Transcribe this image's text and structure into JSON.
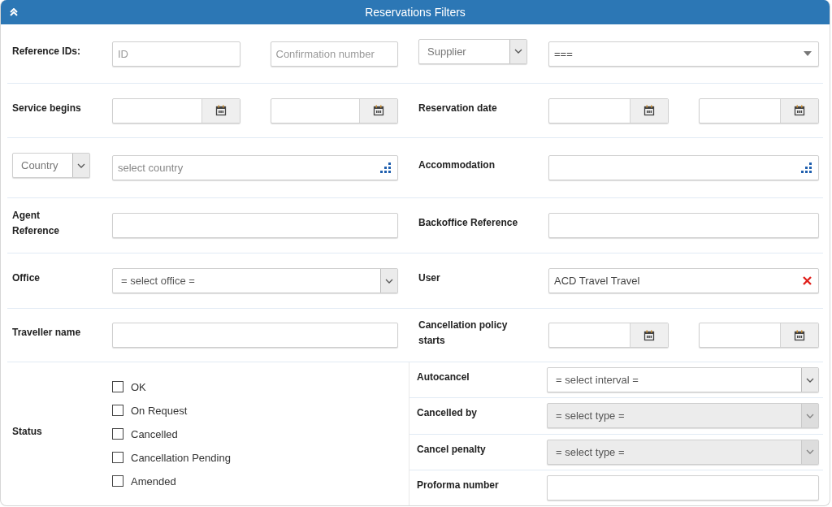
{
  "panel": {
    "title": "Reservations Filters"
  },
  "rows": [
    {
      "left": {
        "label": {
          "kind": "text",
          "text": "Reference IDs:"
        },
        "controls": [
          {
            "kind": "input",
            "placeholder": "ID"
          },
          {
            "kind": "input",
            "placeholder": "Confirmation number"
          }
        ]
      },
      "right": {
        "label": {
          "kind": "select",
          "value": "Supplier"
        },
        "controls": [
          {
            "kind": "combo",
            "value": "==="
          }
        ]
      }
    },
    {
      "left": {
        "label": {
          "kind": "text",
          "text": "Service begins"
        },
        "controls": [
          {
            "kind": "date"
          },
          {
            "kind": "date"
          }
        ]
      },
      "right": {
        "label": {
          "kind": "text",
          "text": "Reservation date"
        },
        "controls": [
          {
            "kind": "date"
          },
          {
            "kind": "date"
          }
        ]
      }
    },
    {
      "left": {
        "label": {
          "kind": "select",
          "value": "Country"
        },
        "controls": [
          {
            "kind": "lookup",
            "placeholder": "select country"
          }
        ]
      },
      "right": {
        "label": {
          "kind": "text",
          "text": "Accommodation"
        },
        "controls": [
          {
            "kind": "lookup"
          }
        ]
      }
    },
    {
      "left": {
        "label": {
          "kind": "text",
          "text": "Agent Reference"
        },
        "controls": [
          {
            "kind": "input"
          }
        ]
      },
      "right": {
        "label": {
          "kind": "text",
          "text": "Backoffice Reference"
        },
        "controls": [
          {
            "kind": "input"
          }
        ]
      }
    },
    {
      "left": {
        "label": {
          "kind": "text",
          "text": "Office"
        },
        "controls": [
          {
            "kind": "select",
            "value": "= select office =",
            "disabled": false
          }
        ]
      },
      "right": {
        "label": {
          "kind": "text",
          "text": "User"
        },
        "controls": [
          {
            "kind": "clearable",
            "value": "ACD Travel Travel"
          }
        ]
      }
    },
    {
      "left": {
        "label": {
          "kind": "text",
          "text": "Traveller name"
        },
        "controls": [
          {
            "kind": "input"
          }
        ]
      },
      "right": {
        "label": {
          "kind": "text",
          "text": "Cancellation policy starts"
        },
        "controls": [
          {
            "kind": "date"
          },
          {
            "kind": "date"
          }
        ]
      }
    }
  ],
  "status": {
    "label": "Status",
    "items": [
      {
        "label": "OK",
        "checked": false
      },
      {
        "label": "On Request",
        "checked": false
      },
      {
        "label": "Cancelled",
        "checked": false
      },
      {
        "label": "Cancellation Pending",
        "checked": false
      },
      {
        "label": "Amended",
        "checked": false
      }
    ]
  },
  "side_rows": [
    {
      "label": {
        "kind": "text",
        "text": "Autocancel"
      },
      "controls": [
        {
          "kind": "select",
          "value": "= select interval =",
          "disabled": false
        }
      ]
    },
    {
      "label": {
        "kind": "text",
        "text": "Cancelled by"
      },
      "controls": [
        {
          "kind": "select",
          "value": "= select type =",
          "disabled": true
        }
      ]
    },
    {
      "label": {
        "kind": "text",
        "text": "Cancel penalty"
      },
      "controls": [
        {
          "kind": "select",
          "value": "= select type =",
          "disabled": true
        }
      ]
    },
    {
      "label": {
        "kind": "text",
        "text": "Proforma number"
      },
      "controls": [
        {
          "kind": "input"
        }
      ]
    }
  ]
}
